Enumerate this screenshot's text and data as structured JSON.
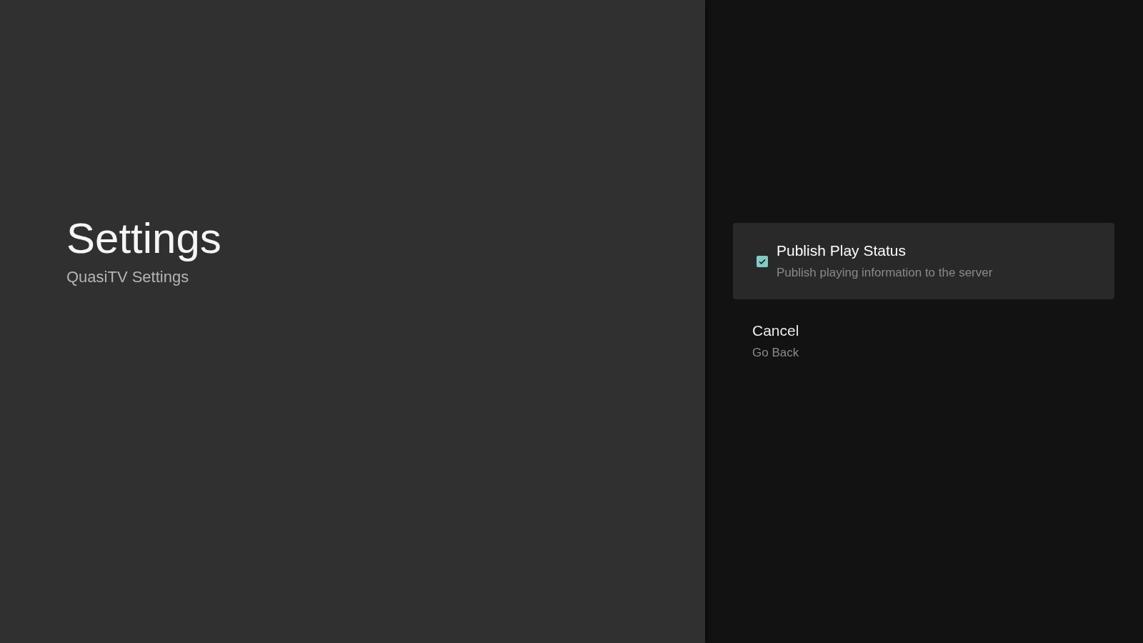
{
  "header": {
    "title": "Settings",
    "subtitle": "QuasiTV Settings"
  },
  "actions": [
    {
      "kind": "checkbox",
      "title": "Publish Play Status",
      "description": "Publish playing information to the server",
      "checked": true,
      "selected": true
    },
    {
      "kind": "action",
      "title": "Cancel",
      "description": "Go Back",
      "selected": false
    }
  ]
}
